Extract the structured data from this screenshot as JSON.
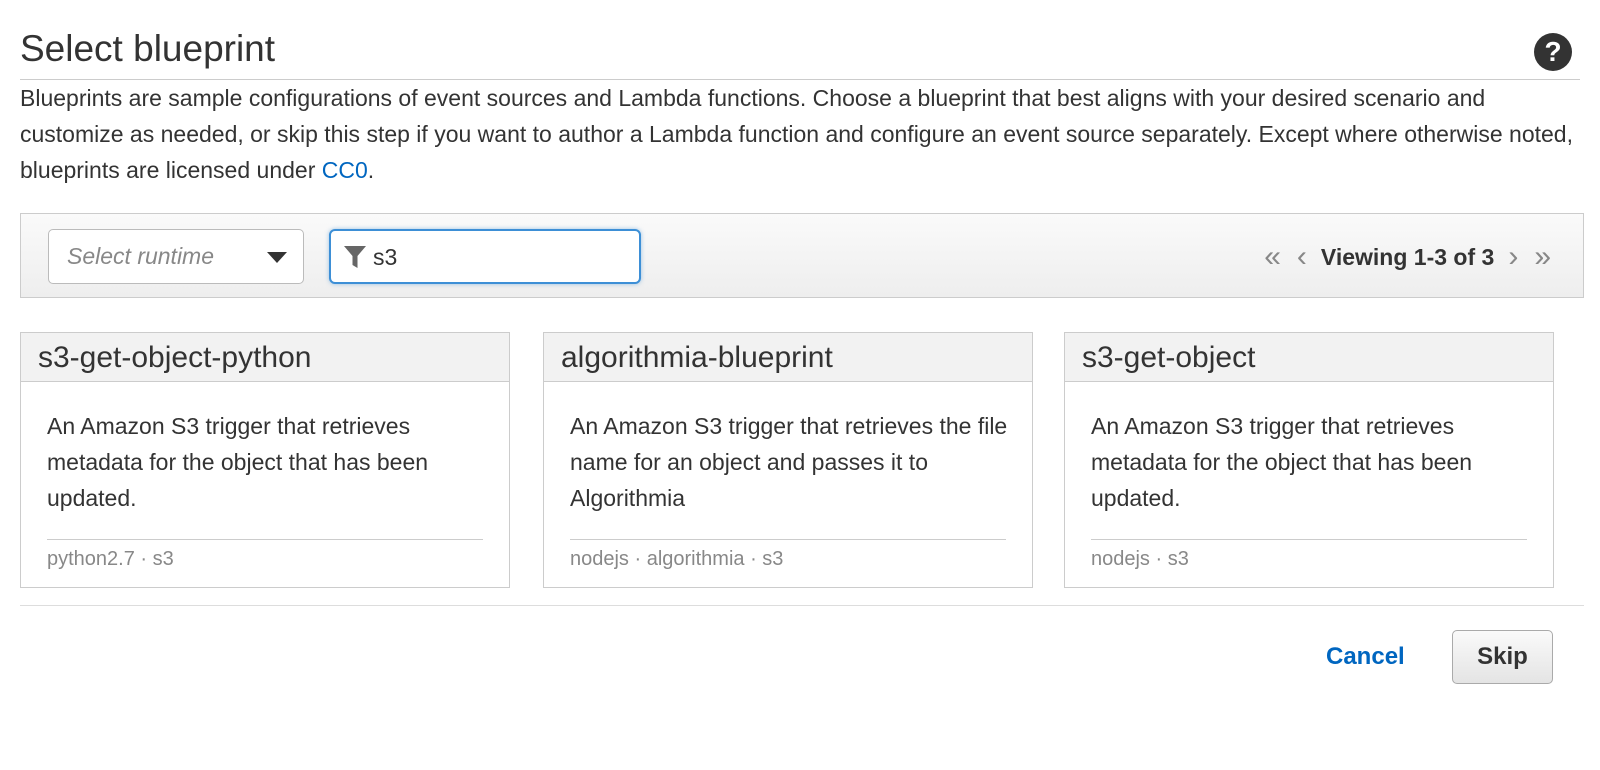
{
  "header": {
    "title": "Select blueprint",
    "help_icon": "question-circle-icon",
    "help_glyph": "?"
  },
  "description": {
    "text": "Blueprints are sample configurations of event sources and Lambda functions. Choose a blueprint that best aligns with your desired scenario and customize as needed, or skip this step if you want to author a Lambda function and configure an event source separately. Except where otherwise noted, blueprints are licensed under ",
    "link_text": "CC0",
    "suffix": "."
  },
  "toolbar": {
    "runtime_placeholder": "Select runtime",
    "filter_value": "s3",
    "pager": {
      "first": "«",
      "prev": "‹",
      "label": "Viewing 1-3 of 3",
      "next": "›",
      "last": "»"
    }
  },
  "cards": [
    {
      "title": "s3-get-object-python",
      "description": "An Amazon S3 trigger that retrieves metadata for the object that has been updated.",
      "tags": "python2.7 · s3"
    },
    {
      "title": "algorithmia-blueprint",
      "description": "An Amazon S3 trigger that retrieves the file name for an object and passes it to Algorithmia",
      "tags": "nodejs · algorithmia · s3"
    },
    {
      "title": "s3-get-object",
      "description": "An Amazon S3 trigger that retrieves metadata for the object that has been updated.",
      "tags": "nodejs · s3"
    }
  ],
  "footer": {
    "cancel_label": "Cancel",
    "skip_label": "Skip"
  },
  "colors": {
    "link": "#0066c0",
    "focus": "#3d8fd6",
    "text": "#333333",
    "muted": "#888888"
  }
}
